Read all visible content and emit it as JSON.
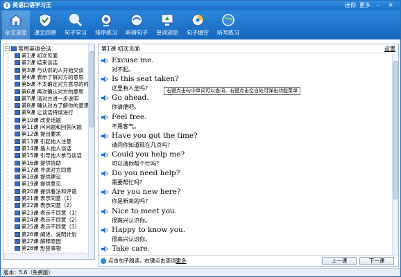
{
  "window": {
    "title": "英语口语学习王",
    "menu_links": [
      "迷你",
      "更多"
    ]
  },
  "toolbar": [
    {
      "label": "全文浏览",
      "icon": "home-icon",
      "active": true
    },
    {
      "label": "课文回想",
      "icon": "shield-icon",
      "active": false
    },
    {
      "label": "句子学习",
      "icon": "magnifier-icon",
      "active": false
    },
    {
      "label": "排序练习",
      "icon": "webcam-icon",
      "active": false
    },
    {
      "label": "听辨句子",
      "icon": "disc-icon",
      "active": false
    },
    {
      "label": "单词浏览",
      "icon": "recycle-monitor-icon",
      "active": false
    },
    {
      "label": "句子填空",
      "icon": "cd-icon",
      "active": false
    },
    {
      "label": "听写练习",
      "icon": "globe-icon",
      "active": false
    }
  ],
  "tree": {
    "root": "常用英语会话",
    "items": [
      "第1课 初次见面",
      "第2课 结束谈话",
      "第3课 与认识的人开始交谈",
      "第4课 表示了解对方的意思",
      "第5课 不太确定对方意思的时",
      "第6课 再次确认对方的意思",
      "第7课 请对方进一步说明",
      "第8课 确认对方了解你的意思",
      "第9课 让谈话持续进行",
      "第10课 改变话题",
      "第11课 问问题和回答问题",
      "第12课 提出要求",
      "第13课 引起他人注意",
      "第14课 插入他人谈话",
      "第15课 引导他人参与谈话",
      "第16课 提供协助",
      "第17课 寻求对方同意",
      "第18课 提供建议",
      "第19课 提供意见",
      "第20课 提供看法和评语",
      "第21课 表示同意（1）",
      "第22课 表示同意（2）",
      "第23课 表示不同意（1）",
      "第24课 表示不同意（2）",
      "第25课 表示不同意（3）",
      "第26课 阐述、说明计划",
      "第27课 解释原因",
      "第28课 形容事物",
      "第29课 赞美别人时/并正式环"
    ]
  },
  "content": {
    "lesson_title": "第1课 初次见面",
    "settings": "设置",
    "sentences": [
      {
        "en": "Excuse me.",
        "zh": "对不起。"
      },
      {
        "en": "Is this seat taken?",
        "zh": "这里有人坐吗？"
      },
      {
        "en": "Go ahead.",
        "zh": "你请便吧。"
      },
      {
        "en": "Feel free.",
        "zh": "不用客气。"
      },
      {
        "en": "Have you got the time?",
        "zh": "请问你知道现在几点吗？"
      },
      {
        "en": "Could you help me?",
        "zh": "可以请你帮个忙吗？"
      },
      {
        "en": "Do you need help?",
        "zh": "需要帮忙吗？"
      },
      {
        "en": "Are you new here?",
        "zh": "你是新来的吗？"
      },
      {
        "en": "Nice to meet you.",
        "zh": "很高兴认识你。"
      },
      {
        "en": "Happy to know you.",
        "zh": "很高兴认识你。"
      },
      {
        "en": "Take care.",
        "zh": ""
      }
    ],
    "tooltip": "右键点击句中单词可以查词，右键点击空白处可弹出功能菜单",
    "hint_text": "点击句子朗读，右键点击查词",
    "hint_link": "更多",
    "prev_button": "上一课",
    "next_button": "下一课"
  },
  "status": {
    "version_label": "版本：",
    "version": "5.6",
    "edition": "（免费版）"
  },
  "colors": {
    "toolbar": "#1b6fc7",
    "speaker": "#1e6bd1",
    "border": "#9fb6cf"
  }
}
